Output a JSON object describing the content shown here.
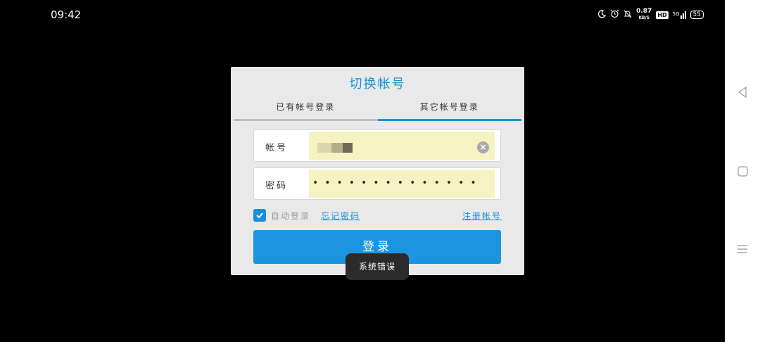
{
  "status_bar": {
    "time": "09:42",
    "net_speed_value": "0.87",
    "net_speed_unit": "KB/S",
    "hd_badge": "HD",
    "signal_label": "5G",
    "battery": "55",
    "icons": [
      "moon-icon",
      "alarm-icon",
      "mute-icon",
      "speed-indicator",
      "hd-icon",
      "signal-icon",
      "battery-icon"
    ]
  },
  "dialog": {
    "title": "切换帐号",
    "tabs": [
      {
        "label": "已有帐号登录",
        "active": false
      },
      {
        "label": "其它帐号登录",
        "active": true
      }
    ],
    "account": {
      "label": "帐号",
      "value_masked": true
    },
    "password": {
      "label": "密码",
      "value": "••••••••••••••"
    },
    "auto_login": {
      "label": "自动登录",
      "checked": true
    },
    "forgot_password": "忘记密码",
    "register": "注册帐号",
    "login_button": "登录"
  },
  "toast": "系统错误",
  "colors": {
    "accent": "#1a8fd8",
    "button": "#1b95e0",
    "input_autofill": "#f7f2c2",
    "dialog_bg": "#e9e9e9"
  },
  "navbar": {
    "icons": [
      "back-icon",
      "home-icon",
      "recents-icon"
    ]
  }
}
